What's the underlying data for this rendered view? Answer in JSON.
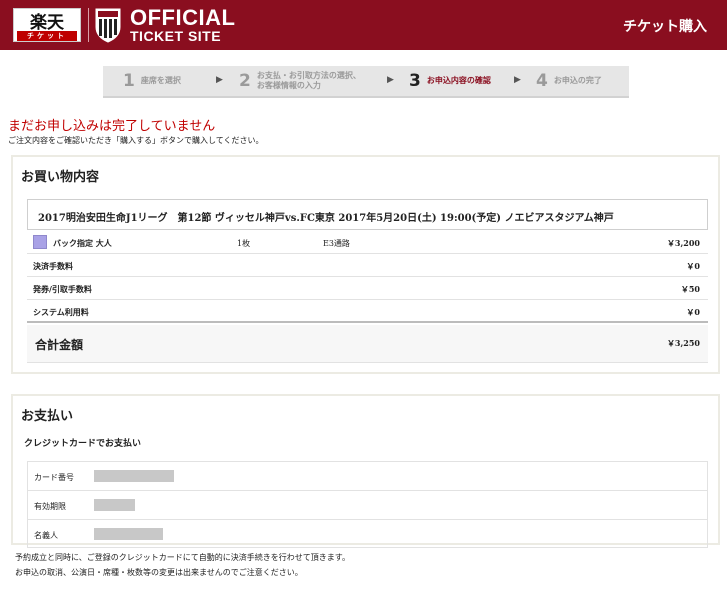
{
  "header": {
    "rakuten_logo_top": "楽天",
    "rakuten_logo_r": "R",
    "rakuten_logo_bottom": "チケット",
    "club_crest": "VISSEL",
    "official": "OFFICIAL",
    "ticket_site": "TICKET SITE",
    "page_title": "チケット購入",
    "brand_color": "#8a0e1f"
  },
  "steps": [
    {
      "num": "1",
      "label_line1": "座席を選択",
      "label_line2": "",
      "active": false
    },
    {
      "num": "2",
      "label_line1": "お支払・お引取方法の選択、",
      "label_line2": "お客様情報の入力",
      "active": false
    },
    {
      "num": "3",
      "label_line1": "お申込内容の確認",
      "label_line2": "",
      "active": true
    },
    {
      "num": "4",
      "label_line1": "お申込の完了",
      "label_line2": "",
      "active": false
    }
  ],
  "messages": {
    "warning": "まだお申し込みは完了していません",
    "instruction": "ご注文内容をご確認いただき「購入する」ボタンで購入してください。"
  },
  "purchase": {
    "title": "お買い物内容",
    "event": "2017明治安田生命J1リーグ　第12節 ヴィッセル神戸vs.FC東京 2017年5月20日(土) 19:00(予定) ノエビアスタジアム神戸",
    "ticket": {
      "type": "バック指定 大人",
      "quantity": "1枚",
      "gate": "E3通路",
      "price": "￥3,200",
      "swatch_color": "#a9a2e6"
    },
    "fees": [
      {
        "label": "決済手数料",
        "amount": "￥0"
      },
      {
        "label": "発券/引取手数料",
        "amount": "￥50"
      },
      {
        "label": "システム利用料",
        "amount": "￥0"
      }
    ],
    "total_label": "合計金額",
    "total_amount": "￥3,250"
  },
  "payment": {
    "title": "お支払い",
    "method": "クレジットカードでお支払い",
    "fields": [
      {
        "label": "カード番号"
      },
      {
        "label": "有効期限"
      },
      {
        "label": "名義人"
      }
    ],
    "note1": "予約成立と同時に、ご登録のクレジットカードにて自動的に決済手続きを行わせて頂きます。",
    "note2": "お申込の取消、公演日・席種・枚数等の変更は出来ませんのでご注意ください。"
  }
}
